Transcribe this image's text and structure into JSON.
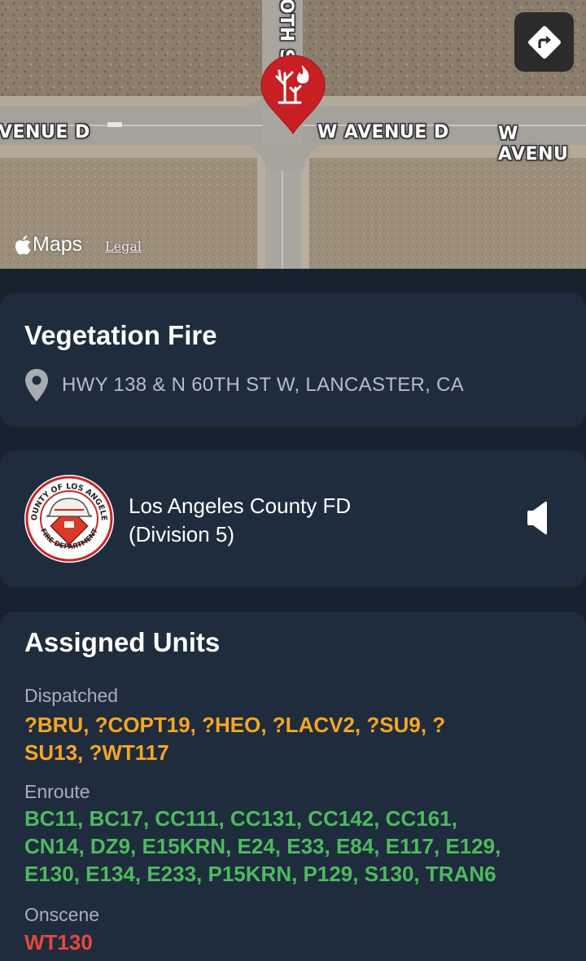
{
  "map": {
    "street_labels": {
      "left": "VENUE D",
      "center": "W AVENUE D",
      "right": "W AVENU",
      "vertical": "OTH S"
    },
    "brand": "Maps",
    "legal": "Legal",
    "pin_icon": "vegetation-fire-icon",
    "directions_icon": "directions-icon"
  },
  "incident": {
    "type": "Vegetation Fire",
    "address": "HWY 138 & N 60TH ST W, LANCASTER, CA",
    "location_icon": "location-pin-icon"
  },
  "agency": {
    "name_line1": "Los Angeles County FD",
    "name_line2": "(Division 5)",
    "logo_text_top": "COUNTY OF LOS ANGELES",
    "logo_text_bottom": "FIRE DEPARTMENT",
    "audio_icon": "speaker-icon"
  },
  "units": {
    "title": "Assigned Units",
    "groups": [
      {
        "label": "Dispatched",
        "line1": "?BRU, ?COPT19, ?HEO, ?LACV2, ?SU9, ?",
        "line2": "SU13, ?WT117",
        "color": "#f5a623"
      },
      {
        "label": "Enroute",
        "line1": "BC11, BC17, CC111, CC131, CC142, CC161,",
        "line2": "CN14, DZ9, E15KRN, E24, E33, E84, E117, E129,",
        "line3": "E130, E134, E233, P15KRN, P129, S130, TRAN6",
        "color": "#4dbb5e"
      },
      {
        "label": "Onscene",
        "line1": "WT130",
        "color": "#e8483d"
      }
    ]
  }
}
